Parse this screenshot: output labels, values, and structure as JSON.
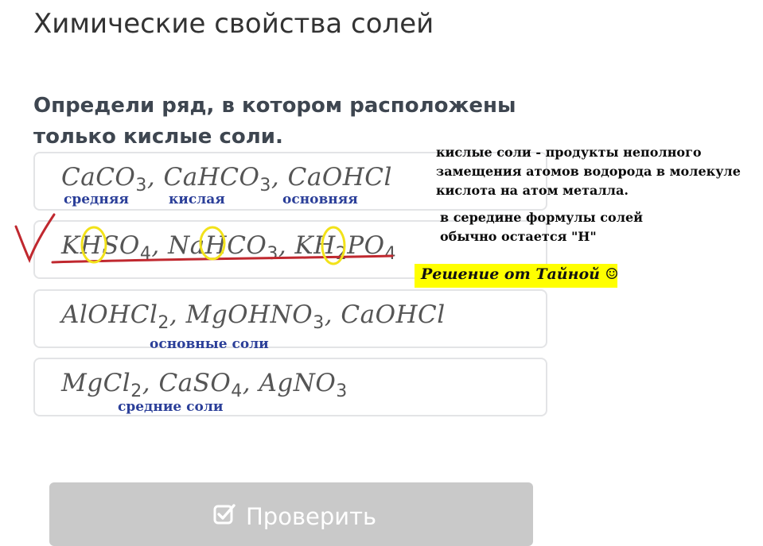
{
  "title": "Химические свойства солей",
  "question": {
    "line1": "Определи ряд, в котором расположены",
    "line2": "только кислые соли."
  },
  "options": [
    {
      "tokens": [
        {
          "t": "CaCO"
        },
        {
          "s": "3"
        },
        {
          "t": ", CaHCO"
        },
        {
          "s": "3"
        },
        {
          "t": ", CaOHCl"
        }
      ],
      "hints": [
        "средняя",
        "кислая",
        "основняя"
      ]
    },
    {
      "tokens": [
        {
          "t": "KHSO"
        },
        {
          "s": "4"
        },
        {
          "t": ", NaHCO"
        },
        {
          "s": "3"
        },
        {
          "t": ", KH"
        },
        {
          "s": "2"
        },
        {
          "t": "PO"
        },
        {
          "s": "4"
        }
      ],
      "hints": []
    },
    {
      "tokens": [
        {
          "t": "AlOHCl"
        },
        {
          "s": "2"
        },
        {
          "t": ", MgOHNO"
        },
        {
          "s": "3"
        },
        {
          "t": ", CaOHCl"
        }
      ],
      "hints": [
        "основные соли"
      ]
    },
    {
      "tokens": [
        {
          "t": "MgCl"
        },
        {
          "s": "2"
        },
        {
          "t": ", CaSO"
        },
        {
          "s": "4"
        },
        {
          "t": ", AgNO"
        },
        {
          "s": "3"
        }
      ],
      "hints": [
        "средние соли"
      ]
    }
  ],
  "notes": {
    "definition": [
      "кислые соли - продукты неполного",
      "замещения атомов водорода в молекуле",
      "кислота на атом металла."
    ],
    "tip": [
      "в середине формулы солей",
      "обычно остается \"Н\""
    ],
    "banner": "Решение от Тайной ☺"
  },
  "check_button": {
    "label": "Проверить",
    "icon": "checkbox-check-icon"
  },
  "colors": {
    "hint_text": "#2b3f99",
    "underline": "#c0282f",
    "circle": "#f2e21a",
    "banner_bg": "#ffff00",
    "button_bg": "#c9c9c9"
  }
}
